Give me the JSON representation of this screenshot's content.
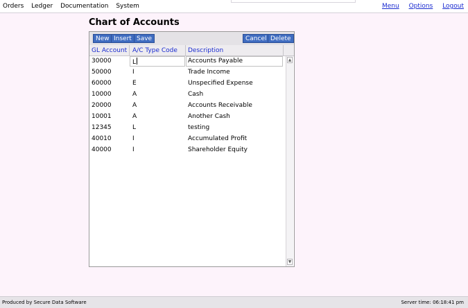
{
  "topbar": {
    "menu_left": [
      "Orders",
      "Ledger",
      "Documentation",
      "System"
    ],
    "menu_right": [
      "Menu",
      "Options",
      "Logout"
    ]
  },
  "page": {
    "title": "Chart of Accounts"
  },
  "toolbar": {
    "new_label": "New",
    "insert_label": "Insert",
    "save_label": "Save",
    "cancel_label": "Cancel",
    "delete_label": "Delete"
  },
  "grid": {
    "columns": [
      "GL Account",
      "A/C Type Code",
      "Description"
    ],
    "rows": [
      [
        "30000",
        "L",
        "Accounts Payable"
      ],
      [
        "50000",
        "I",
        "Trade Income"
      ],
      [
        "60000",
        "E",
        "Unspecified Expense"
      ],
      [
        "10000",
        "A",
        "Cash"
      ],
      [
        "20000",
        "A",
        "Accounts Receivable"
      ],
      [
        "10001",
        "A",
        "Another Cash"
      ],
      [
        "12345",
        "L",
        "testing"
      ],
      [
        "40010",
        "I",
        "Accumulated Profit"
      ],
      [
        "40000",
        "I",
        "Shareholder Equity"
      ]
    ]
  },
  "footer": {
    "produced_by": "Produced by Secure Data Software",
    "server_time": "Server time: 06:18:41 pm"
  },
  "colors": {
    "button": "#3f6cc0",
    "link": "#1a2bd0",
    "background": "#fdf3fb"
  }
}
